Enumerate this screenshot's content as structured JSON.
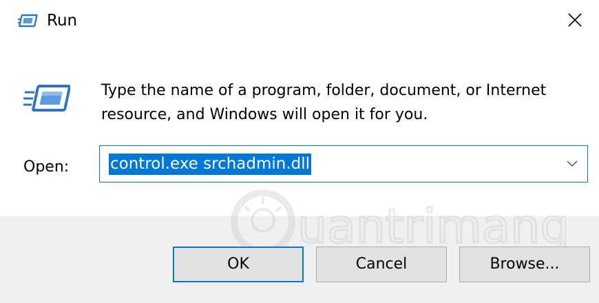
{
  "window": {
    "title": "Run",
    "icon": "run-icon",
    "close_icon": "close-icon"
  },
  "content": {
    "icon": "run-icon",
    "description": "Type the name of a program, folder, document, or Internet resource, and Windows will open it for you."
  },
  "open_field": {
    "label": "Open:",
    "value": "control.exe srchadmin.dll",
    "dropdown_icon": "chevron-down-icon"
  },
  "buttons": {
    "ok": "OK",
    "cancel": "Cancel",
    "browse": "Browse..."
  },
  "colors": {
    "accent": "#0078d7",
    "footer_bg": "#f0f0f0",
    "button_bg": "#e1e1e1",
    "icon_blue": "#2f73c5"
  },
  "watermark": {
    "text": "uantrimang"
  }
}
